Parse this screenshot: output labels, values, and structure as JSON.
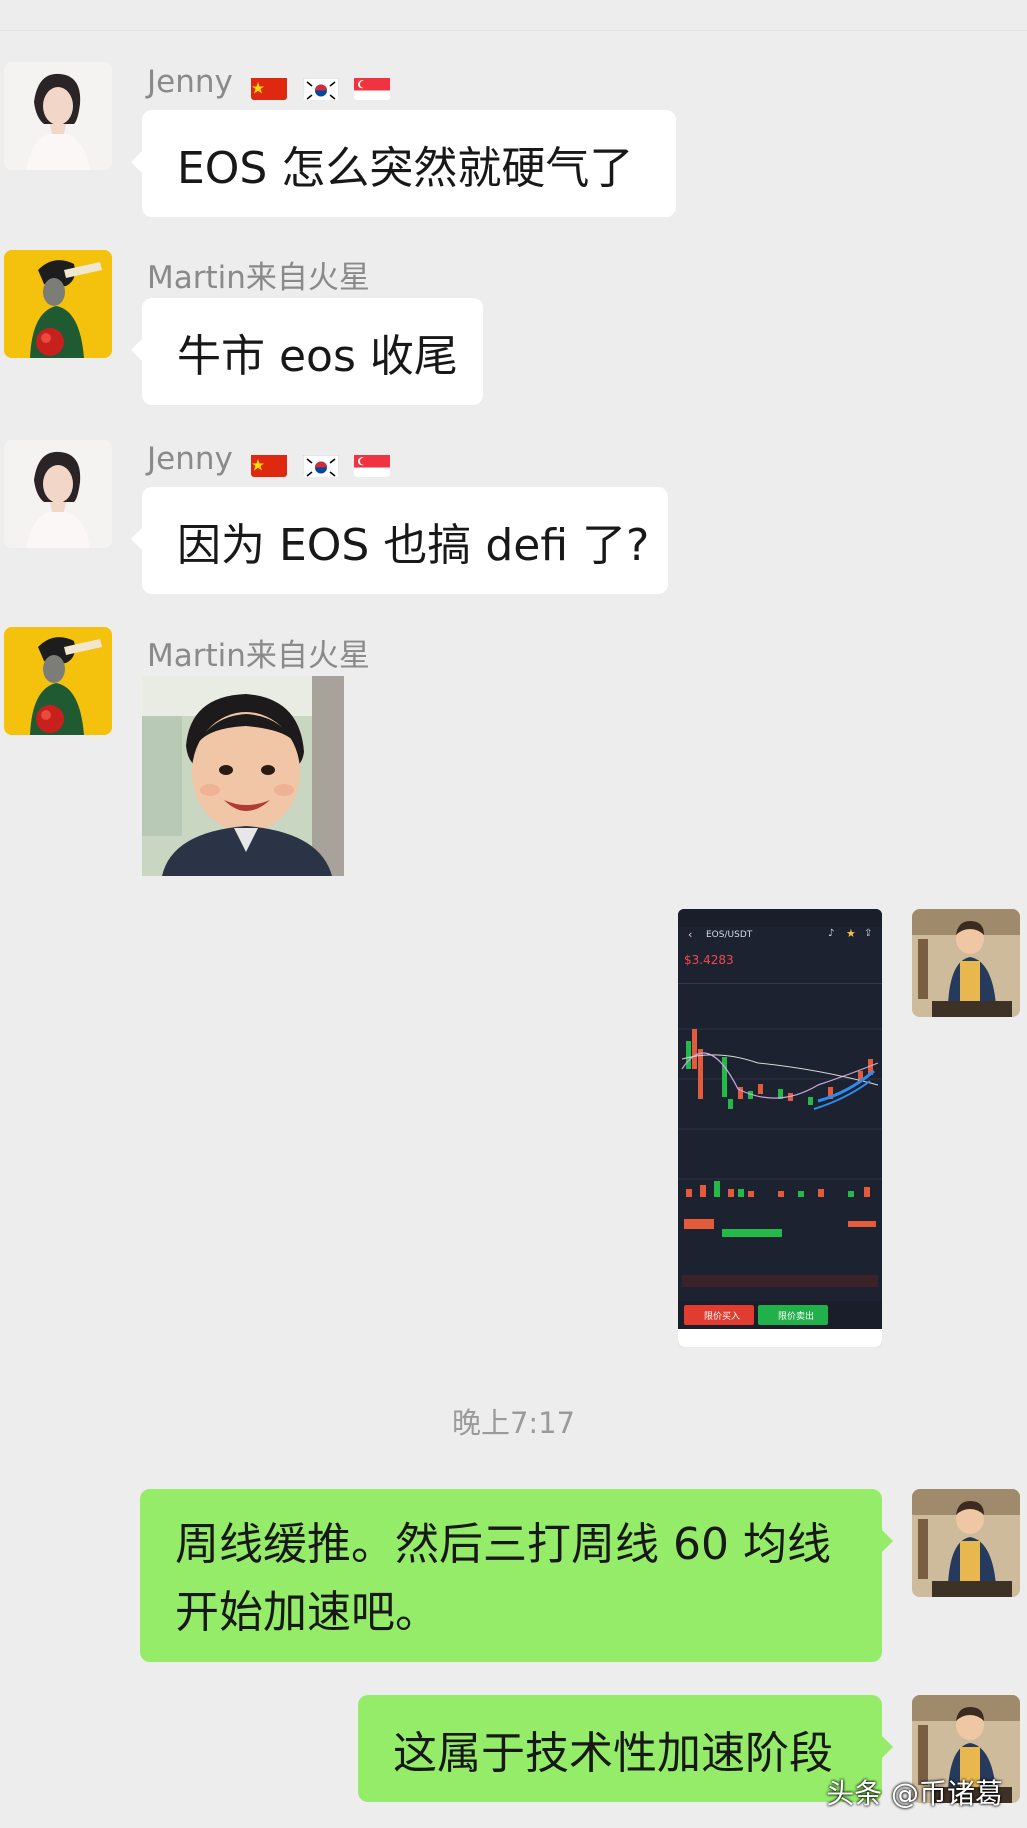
{
  "messages": [
    {
      "sender": "Jenny",
      "text": "EOS 怎么突然就硬气了"
    },
    {
      "sender": "Martin来自火星",
      "text": "牛市 eos 收尾"
    },
    {
      "sender": "Jenny",
      "text": "因为 EOS 也搞 defi 了?"
    },
    {
      "sender": "Martin来自火星",
      "type": "sticker"
    }
  ],
  "screenshot": {
    "pair": "EOS/USDT",
    "price": "$3.4283",
    "buy_label": "限价买入",
    "sell_label": "限价卖出"
  },
  "timestamp": "晚上7:17",
  "outgoing": [
    {
      "text": "周线缓推。然后三打周线 60 均线开始加速吧。"
    },
    {
      "text": "这属于技术性加速阶段"
    }
  ],
  "watermark": "头条 @币诸葛",
  "colors": {
    "bubble_sent": "#95ec69",
    "bubble_received": "#ffffff",
    "background": "#ededed"
  }
}
